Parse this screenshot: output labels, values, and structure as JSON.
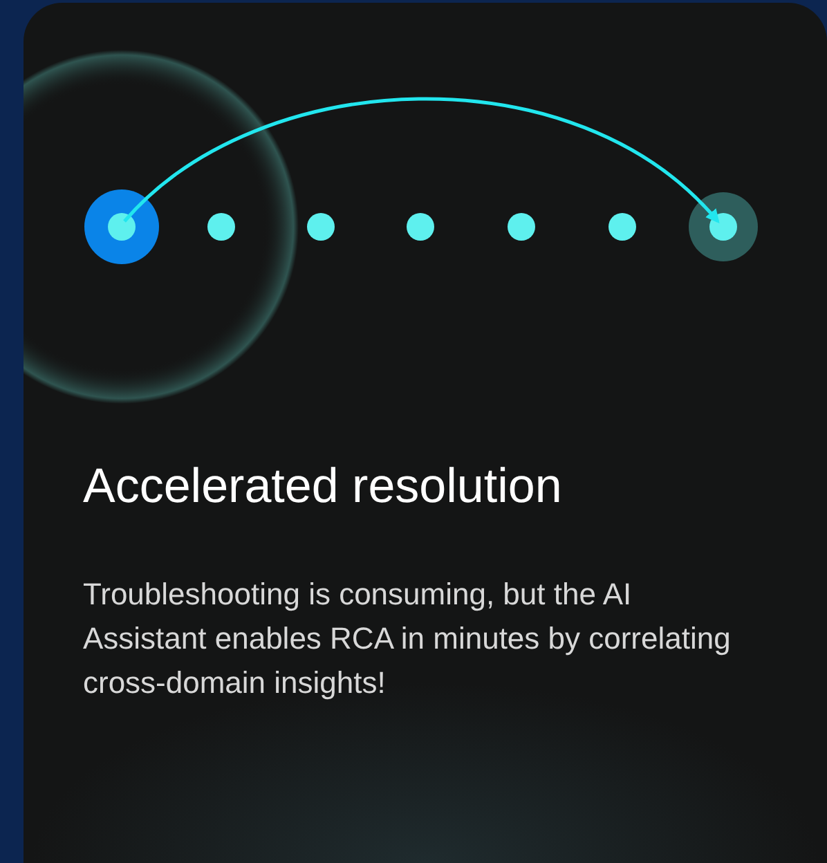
{
  "card": {
    "title": "Accelerated resolution",
    "description": "Troubleshooting is consuming, but the AI Assistant enables RCA in minutes by correlating cross-domain insights!"
  }
}
